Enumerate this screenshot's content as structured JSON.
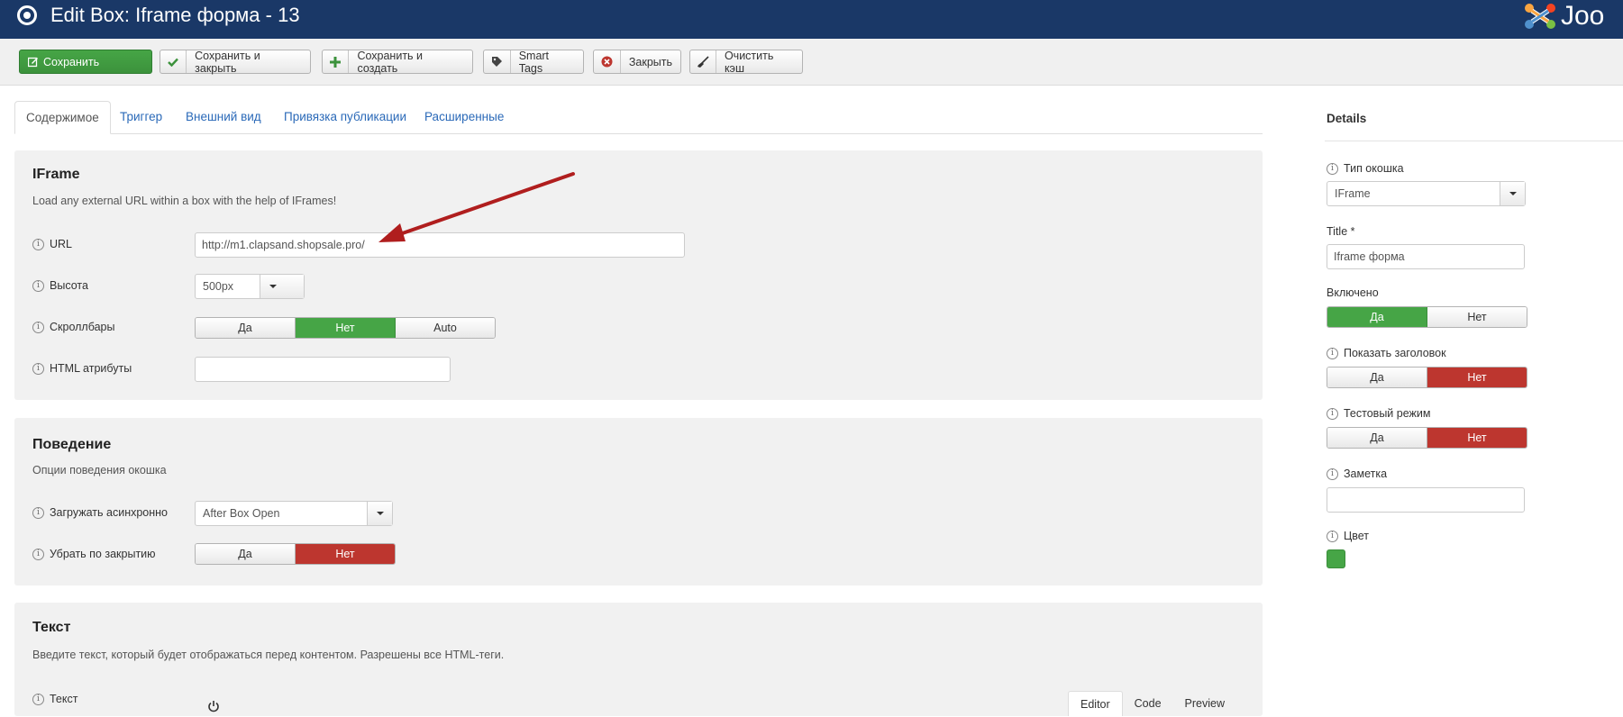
{
  "header": {
    "title": "Edit Box: Iframe форма - 13",
    "logo_text": "Joo"
  },
  "toolbar": {
    "save": "Сохранить",
    "save_close": "Сохранить и закрыть",
    "save_new": "Сохранить и создать",
    "smart_tags": "Smart Tags",
    "close": "Закрыть",
    "clear_cache": "Очистить кэш"
  },
  "tabs": [
    {
      "label": "Содержимое",
      "active": true
    },
    {
      "label": "Триггер"
    },
    {
      "label": "Внешний вид"
    },
    {
      "label": "Привязка публикации"
    },
    {
      "label": "Расширенные"
    }
  ],
  "iframe_panel": {
    "title": "IFrame",
    "description": "Load any external URL within a box with the help of IFrames!",
    "url_label": "URL",
    "url_value": "http://m1.clapsand.shopsale.pro/",
    "height_label": "Высота",
    "height_value": "500px",
    "scrollbars_label": "Скроллбары",
    "scrollbars_options": [
      "Да",
      "Нет",
      "Auto"
    ],
    "html_attr_label": "HTML атрибуты",
    "html_attr_value": ""
  },
  "behavior_panel": {
    "title": "Поведение",
    "description": "Опции поведения окошка",
    "async_label": "Загружать асинхронно",
    "async_value": "After Box Open",
    "remove_label": "Убрать по закрытию",
    "remove_options": [
      "Да",
      "Нет"
    ]
  },
  "text_panel": {
    "title": "Текст",
    "description": "Введите текст, который будет отображаться перед контентом. Разрешены все HTML-теги.",
    "text_label": "Текст",
    "editor_tabs": [
      "Editor",
      "Code",
      "Preview"
    ]
  },
  "sidebar": {
    "title": "Details",
    "type_label": "Тип окошка",
    "type_value": "IFrame",
    "title_label": "Title *",
    "title_value": "Iframe форма",
    "enabled_label": "Включено",
    "enabled_options": [
      "Да",
      "Нет"
    ],
    "show_title_label": "Показать заголовок",
    "show_title_options": [
      "Да",
      "Нет"
    ],
    "test_mode_label": "Тестовый режим",
    "test_mode_options": [
      "Да",
      "Нет"
    ],
    "note_label": "Заметка",
    "note_value": "",
    "color_label": "Цвет",
    "color_value": "#46a546"
  },
  "colors": {
    "header_bg": "#1a3867",
    "green": "#46a546",
    "red": "#bd362f",
    "arrow": "#b01e1e"
  }
}
